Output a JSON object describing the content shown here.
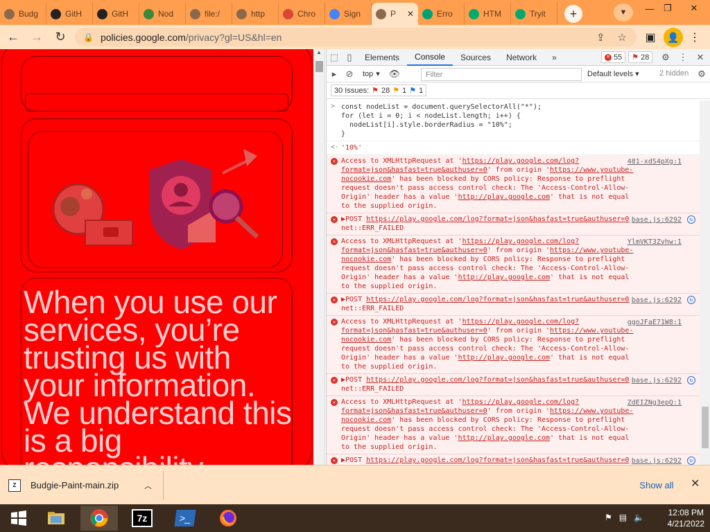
{
  "browser": {
    "tabs": [
      {
        "label": "Budg",
        "icon": "globe-icon",
        "color": "#8a6a4a"
      },
      {
        "label": "GitH",
        "icon": "github-icon",
        "color": "#222222"
      },
      {
        "label": "GitH",
        "icon": "github-icon",
        "color": "#222222"
      },
      {
        "label": "Nod",
        "icon": "nodejs-icon",
        "color": "#3c873a"
      },
      {
        "label": "file:/",
        "icon": "globe-icon",
        "color": "#8a6a4a"
      },
      {
        "label": "http",
        "icon": "globe-icon",
        "color": "#8a6a4a"
      },
      {
        "label": "Chro",
        "icon": "chrome-icon",
        "color": "#db4437"
      },
      {
        "label": "Sign",
        "icon": "google-icon",
        "color": "#4285f4"
      },
      {
        "label": "P",
        "icon": "globe-icon",
        "color": "#8a6a4a",
        "active": true
      },
      {
        "label": "Erro",
        "icon": "play-icon",
        "color": "#00a173"
      },
      {
        "label": "HTM",
        "icon": "w3schools-icon",
        "color": "#04aa6d"
      },
      {
        "label": "Tryit",
        "icon": "w3schools-icon",
        "color": "#04aa6d"
      }
    ],
    "new_tab": "+",
    "url_domain": "policies.google.com",
    "url_path": "/privacy?gl=US&hl=en"
  },
  "page": {
    "hero_text": "When you use our services, you’re trusting us with your information. We understand this is a big responsibility"
  },
  "devtools": {
    "tabs": [
      "Elements",
      "Console",
      "Sources",
      "Network"
    ],
    "more": "»",
    "error_count": "55",
    "warning_count": "28",
    "context": "top",
    "filter_placeholder": "Filter",
    "levels": "Default levels",
    "hidden": "2 hidden",
    "issues_label": "30 Issues:",
    "issues_errors": "28",
    "issues_warnings": "1",
    "issues_info": "1",
    "code_lines": [
      "const nodeList = document.querySelectorAll(\"*\");",
      "for (let i = 0; i < nodeList.length; i++) {",
      "  nodeList[i].style.borderRadius = \"10%\";",
      "}"
    ],
    "result": "'10%'",
    "cors_errors": [
      {
        "url": "https://play.google.com/log?format=json&hasfast=true&authuser=0",
        "src": "481-xdS4pXg:1"
      },
      {
        "url": "https://play.google.com/log?format=json&hasfast=true&authuser=0",
        "src": "YlmVKT3Zvhw:1"
      },
      {
        "url": "https://play.google.com/log?format=json&hasfast=true&authuser=0",
        "src": "ggoJFaE71W8:1"
      },
      {
        "url": "https://play.google.com/log?format=json&hasfast=true&authuser=0",
        "src": "ZdEIZNg3epQ:1"
      }
    ],
    "cors_prefix": "Access to XMLHttpRequest at '",
    "cors_origin_text": "' from origin '",
    "cors_origin": "https://www.youtube-nocookie.com",
    "cors_rest": "' has been blocked by CORS policy: Response to preflight request doesn't pass access control check: The 'Access-Control-Allow-Origin' header has a value '",
    "cors_value": "http://play.google.com",
    "cors_tail": "' that is not equal to the supplied origin.",
    "post_prefix": "▶POST ",
    "post_url": "https://play.google.com/log?format=json&hasfast=true&authuser=0",
    "post_error": " net::ERR_FAILED",
    "post_src": "base.js:6292",
    "prompt": ">"
  },
  "download": {
    "file": "Budgie-Paint-main.zip",
    "show_all": "Show all"
  },
  "taskbar": {
    "time": "12:08 PM",
    "date": "4/21/2022"
  }
}
